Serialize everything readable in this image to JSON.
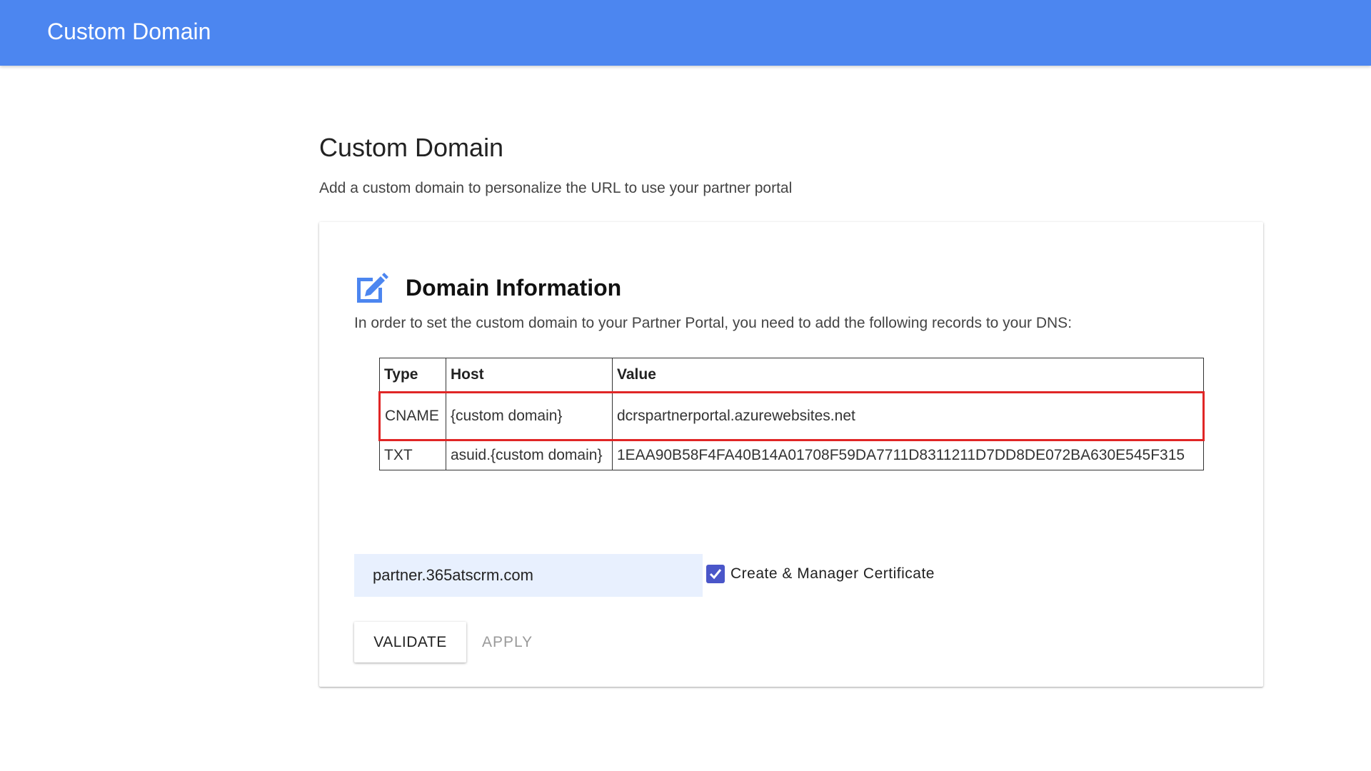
{
  "app_bar": {
    "title": "Custom Domain",
    "color": "#4c86f0"
  },
  "page": {
    "title": "Custom Domain",
    "subtitle": "Add a custom domain to personalize the URL to use your partner portal"
  },
  "card": {
    "icon": "edit-icon",
    "title": "Domain Information",
    "description": "In order to set the custom domain to your Partner Portal, you need to add the following records to your DNS:",
    "table": {
      "headers": [
        "Type",
        "Host",
        "Value"
      ],
      "rows": [
        {
          "type": "CNAME",
          "host": "{custom domain}",
          "value": "dcrspartnerportal.azurewebsites.net",
          "highlighted": true
        },
        {
          "type": "TXT",
          "host": "asuid.{custom domain}",
          "value": "1EAA90B58F4FA40B14A01708F59DA7711D8311211D7DD8DE072BA630E545F315",
          "highlighted": false
        }
      ]
    },
    "domain_input": {
      "value": "partner.365atscrm.com",
      "placeholder": ""
    },
    "certificate_checkbox": {
      "label": "Create & Manager Certificate",
      "checked": true,
      "color": "#4a56c9"
    },
    "buttons": {
      "validate": "VALIDATE",
      "apply": "APPLY"
    },
    "highlight_color": "#e02626"
  }
}
